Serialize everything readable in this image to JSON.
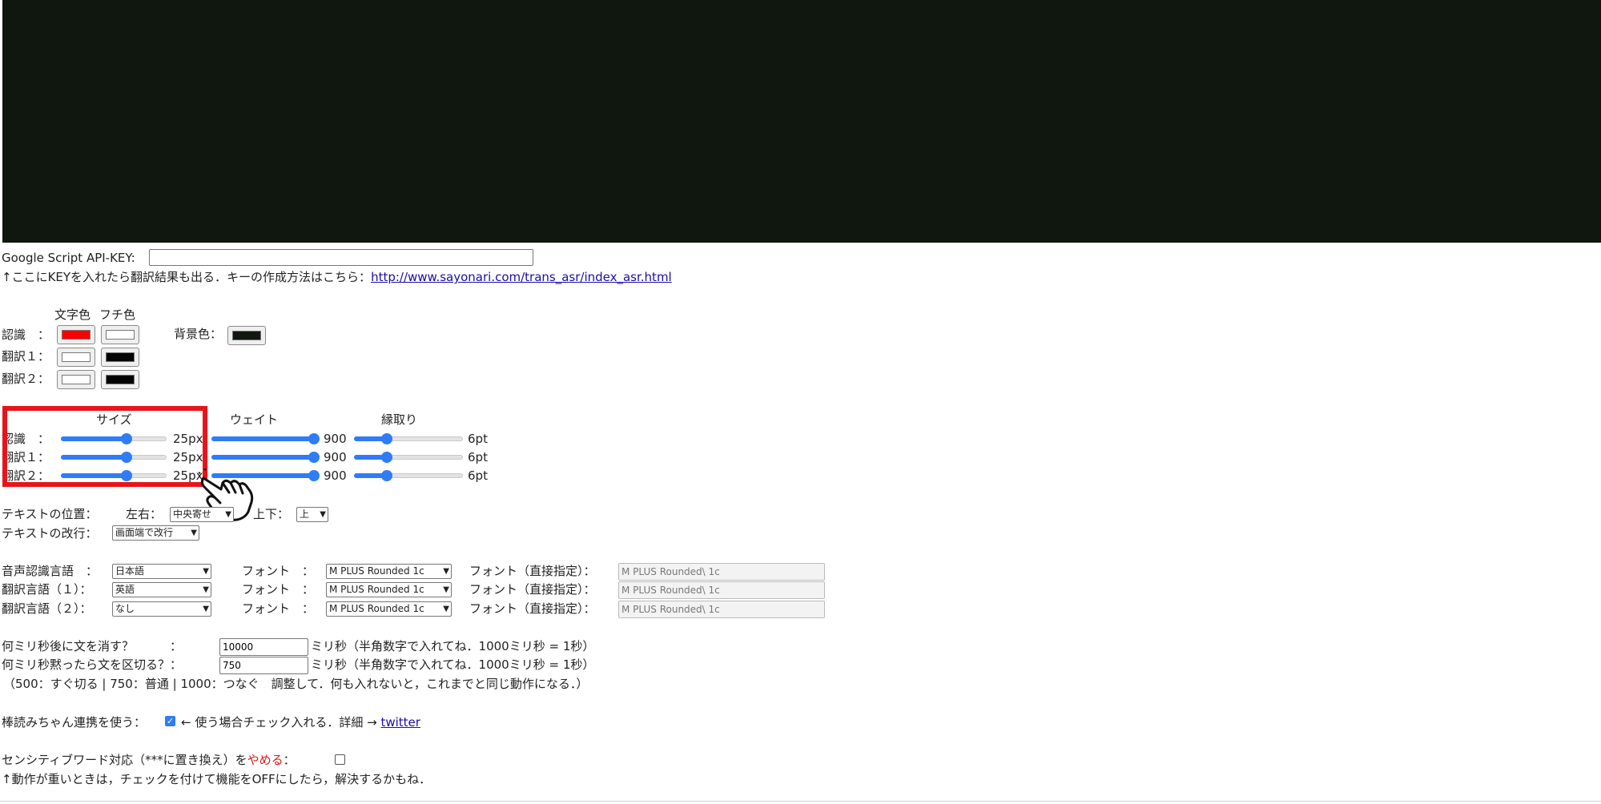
{
  "colors": {
    "preview_bg": "#0f170e",
    "highlight": "#e8141a",
    "accent": "#2f7cf6",
    "link": "#1a0dab"
  },
  "api": {
    "label": "Google Script API-KEY:",
    "value": "",
    "note": "↑ここにKEYを入れたら翻訳結果も出る．キーの作成方法はこちら：",
    "link": "http://www.sayonari.com/trans_asr/index_asr.html"
  },
  "colorbox": {
    "header_text": "文字色",
    "header_edge": "フチ色",
    "rows": [
      {
        "label": "認識　：",
        "text_color": "#ff0000",
        "edge_color": "#ffffff"
      },
      {
        "label": "翻訳１：",
        "text_color": "#ffffff",
        "edge_color": "#000000"
      },
      {
        "label": "翻訳２：",
        "text_color": "#ffffff",
        "edge_color": "#000000"
      }
    ],
    "bg_label": "背景色：",
    "bg_color": "#101810"
  },
  "sliders": {
    "header_size": "サイズ",
    "header_weight": "ウェイト",
    "header_edge": "縁取り",
    "rows": [
      {
        "label": "認識　：",
        "size": 0.62,
        "size_text": "25px",
        "weight": 1.0,
        "weight_text": "900",
        "edge": 0.3,
        "edge_text": "6pt"
      },
      {
        "label": "翻訳１：",
        "size": 0.62,
        "size_text": "25px",
        "weight": 1.0,
        "weight_text": "900",
        "edge": 0.3,
        "edge_text": "6pt"
      },
      {
        "label": "翻訳２：",
        "size": 0.62,
        "size_text": "25px",
        "weight": 1.0,
        "weight_text": "900",
        "edge": 0.3,
        "edge_text": "6pt"
      }
    ]
  },
  "position": {
    "label": "テキストの位置：",
    "lr_label": "左右：",
    "lr_value": "中央寄せ",
    "ud_label": "上下：",
    "ud_value": "上",
    "wrap_label": "テキストの改行：",
    "wrap_value": "画面端で改行"
  },
  "langs": [
    {
      "label": "音声認識言語　：",
      "lang": "日本語",
      "font_label": "フォント　：",
      "font": "M PLUS Rounded 1c",
      "direct_label": "フォント（直接指定）：",
      "direct": "M PLUS Rounded\\ 1c"
    },
    {
      "label": "翻訳言語（１）：",
      "lang": "英語",
      "font_label": "フォント　：",
      "font": "M PLUS Rounded 1c",
      "direct_label": "フォント（直接指定）：",
      "direct": "M PLUS Rounded\\ 1c"
    },
    {
      "label": "翻訳言語（２）：",
      "lang": "なし",
      "font_label": "フォント　：",
      "font": "M PLUS Rounded 1c",
      "direct_label": "フォント（直接指定）：",
      "direct": "M PLUS Rounded\\ 1c"
    }
  ],
  "timing": {
    "clear_label": "何ミリ秒後に文を消す？　　　：",
    "clear_value": "10000",
    "clear_note": "ミリ秒（半角数字で入れてね．1000ミリ秒 = 1秒）",
    "split_label": "何ミリ秒黙ったら文を区切る？：",
    "split_value": "750",
    "split_note": "ミリ秒（半角数字で入れてね．1000ミリ秒 = 1秒）",
    "hint": "（500：すぐ切る | 750：普通 | 1000：つなぐ　調整して．何も入れないと，これまでと同じ動作になる．）"
  },
  "bouyomi": {
    "label": "棒読みちゃん連携を使う：",
    "checked": true,
    "note": "← 使う場合チェック入れる．詳細 →",
    "link": "twitter"
  },
  "sensitive": {
    "label_a": "センシティブワード対応（***に置き換え）を",
    "label_b": "やめる",
    "label_c": "：",
    "checked": false,
    "note": "↑動作が重いときは，チェックを付けて機能をOFFにしたら，解決するかもね．"
  }
}
